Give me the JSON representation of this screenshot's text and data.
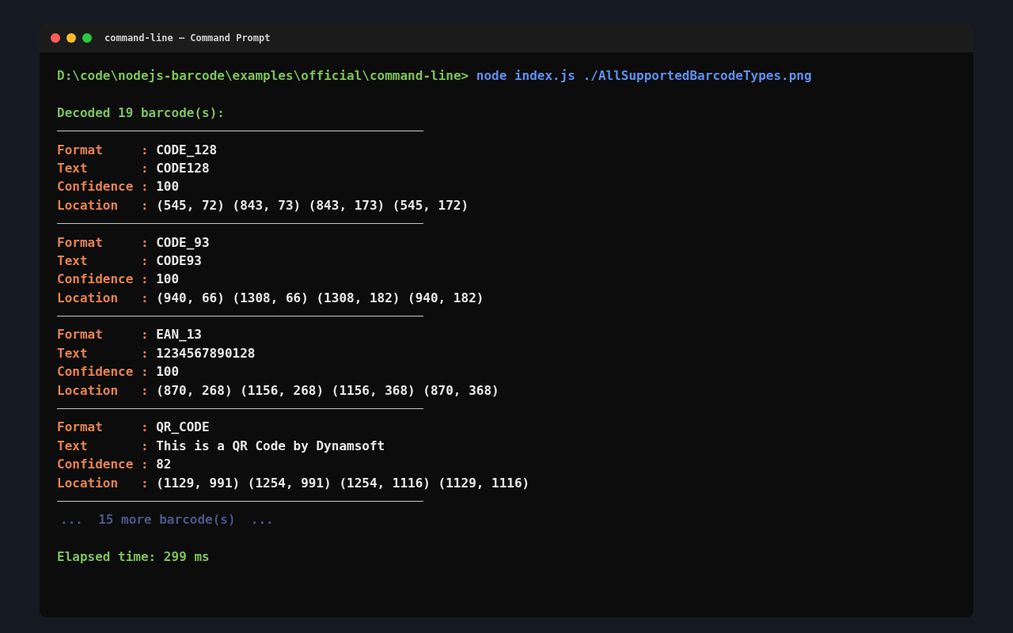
{
  "window": {
    "title": "command-line – Command Prompt"
  },
  "prompt": {
    "path": "D:\\code\\nodejs-barcode\\examples\\official\\command-line>",
    "command": "node index.js ./AllSupportedBarcodeTypes.png"
  },
  "summary": "Decoded 19 barcode(s):",
  "results": [
    {
      "fields": [
        {
          "label": "Format     :",
          "value": "CODE_128"
        },
        {
          "label": "Text       :",
          "value": "CODE128"
        },
        {
          "label": "Confidence :",
          "value": "100"
        },
        {
          "label": "Location   :",
          "value": "(545, 72) (843, 73) (843, 173) (545, 172)"
        }
      ]
    },
    {
      "fields": [
        {
          "label": "Format     :",
          "value": "CODE_93"
        },
        {
          "label": "Text       :",
          "value": "CODE93"
        },
        {
          "label": "Confidence :",
          "value": "100"
        },
        {
          "label": "Location   :",
          "value": "(940, 66) (1308, 66) (1308, 182) (940, 182)"
        }
      ]
    },
    {
      "fields": [
        {
          "label": "Format     :",
          "value": "EAN_13"
        },
        {
          "label": "Text       :",
          "value": "1234567890128"
        },
        {
          "label": "Confidence :",
          "value": "100"
        },
        {
          "label": "Location   :",
          "value": "(870, 268) (1156, 268) (1156, 368) (870, 368)"
        }
      ]
    },
    {
      "fields": [
        {
          "label": "Format     :",
          "value": "QR_CODE"
        },
        {
          "label": "Text       :",
          "value": "This is a QR Code by Dynamsoft"
        },
        {
          "label": "Confidence :",
          "value": "82"
        },
        {
          "label": "Location   :",
          "value": "(1129, 991) (1254, 991) (1254, 1116) (1129, 1116)"
        }
      ]
    }
  ],
  "more": "...  15 more barcode(s)  ...",
  "elapsed": "Elapsed time: 299 ms"
}
